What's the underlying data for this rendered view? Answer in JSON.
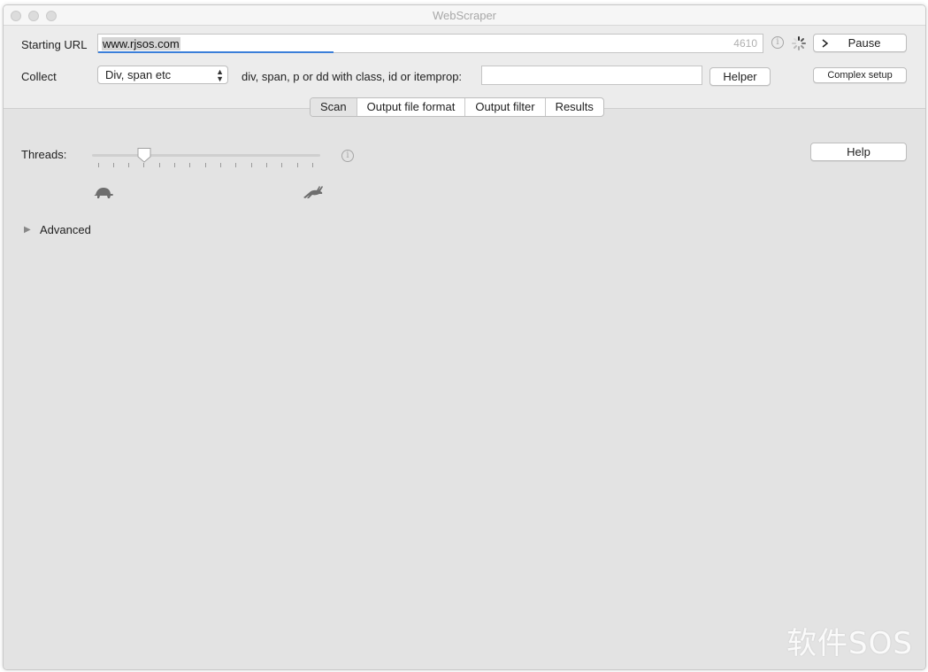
{
  "window": {
    "title": "WebScraper"
  },
  "url": {
    "label": "Starting URL",
    "value": "www.rjsos.com",
    "count": "4610"
  },
  "controls": {
    "pause_label": "Pause",
    "complex_label": "Complex setup"
  },
  "collect": {
    "label": "Collect",
    "selected": "Div, span etc",
    "field_label": "div, span, p or dd with class, id or itemprop:",
    "field_value": "",
    "helper_label": "Helper"
  },
  "tabs": [
    {
      "label": "Scan",
      "active": true
    },
    {
      "label": "Output file format",
      "active": false
    },
    {
      "label": "Output filter",
      "active": false
    },
    {
      "label": "Results",
      "active": false
    }
  ],
  "scan": {
    "threads_label": "Threads:",
    "threads_level": 0.23,
    "help_label": "Help",
    "advanced_label": "Advanced"
  },
  "icons": {
    "info": "info-icon",
    "spinner": "spinner-icon",
    "play": "chevron-right-icon",
    "slow": "tortoise-icon",
    "fast": "hare-icon",
    "disclosure": "triangle-right-icon"
  },
  "watermark": "软件SOS"
}
